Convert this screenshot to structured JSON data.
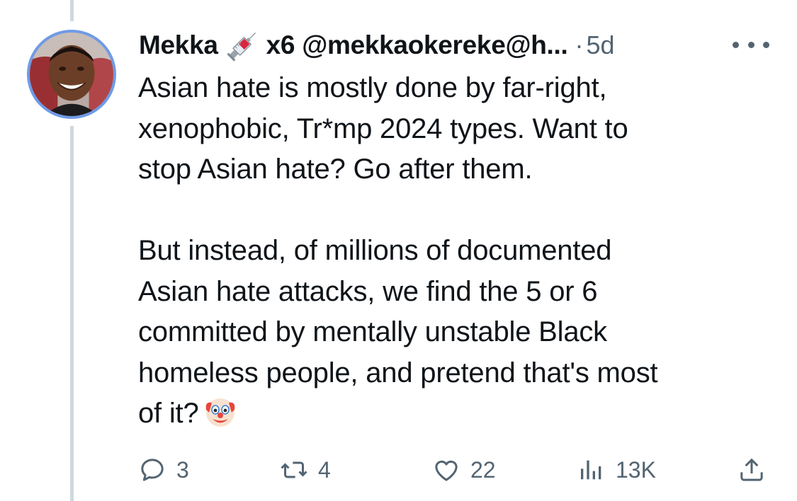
{
  "tweet": {
    "display_name": "Mekka",
    "badge_suffix": "x6",
    "handle": "@mekkaokereke@h...",
    "separator": "·",
    "time": "5d",
    "text_lines": [
      "Asian hate is mostly done by far-right,",
      "xenophobic, Tr*mp 2024 types. Want to",
      "stop Asian hate? Go after them.",
      "",
      "But instead, of millions of documented",
      "Asian hate attacks, we find the 5 or 6",
      "committed by mentally unstable Black",
      "homeless people, and pretend that's most",
      "of it?"
    ]
  },
  "actions": {
    "replies": "3",
    "reposts": "4",
    "likes": "22",
    "views": "13K"
  },
  "icons": {
    "badge": "syringe-icon",
    "end_emoji": "clown-face-icon",
    "more": "more-horizontal-icon",
    "reply": "reply-icon",
    "repost": "repost-icon",
    "like": "heart-icon",
    "views": "views-icon",
    "share": "share-icon"
  },
  "colors": {
    "text": "#0f1419",
    "secondary": "#536471",
    "thread_line": "#cfd9de"
  }
}
